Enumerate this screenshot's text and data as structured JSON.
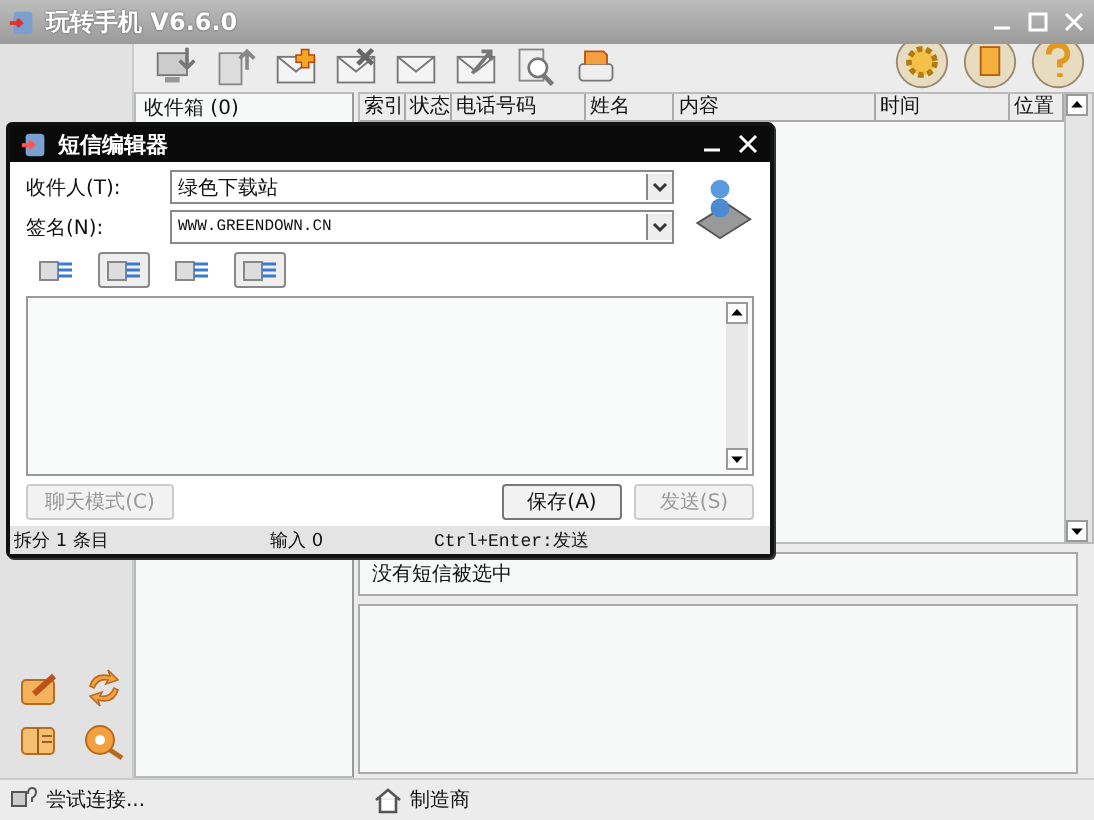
{
  "window": {
    "title": "玩转手机 V6.6.0"
  },
  "folders": [
    {
      "label": "收件箱 (0)",
      "selected": false
    }
  ],
  "table": {
    "columns": [
      "索引",
      "状态",
      "电话号码",
      "姓名",
      "内容",
      "时间",
      "位置"
    ]
  },
  "preview": {
    "text": "没有短信被选中"
  },
  "status_bar": {
    "connection": "尝试连接...",
    "vendor": "制造商"
  },
  "dialog": {
    "title": "短信编辑器",
    "fields": [
      {
        "label": "收件人(T):",
        "value": "绿色下载站"
      },
      {
        "label": "签名(N):",
        "value": "WWW.GREENDOWN.CN"
      }
    ],
    "tools": [
      {
        "on": false
      },
      {
        "on": true
      },
      {
        "on": false
      },
      {
        "on": true
      }
    ],
    "buttons": [
      {
        "label": "聊天模式(C)",
        "disabled": true
      },
      {
        "label": "保存(A)",
        "disabled": false
      },
      {
        "label": "发送(S)",
        "disabled": true
      }
    ],
    "status": [
      "拆分 1 条目",
      "输入 0",
      "Ctrl+Enter:发送"
    ]
  }
}
